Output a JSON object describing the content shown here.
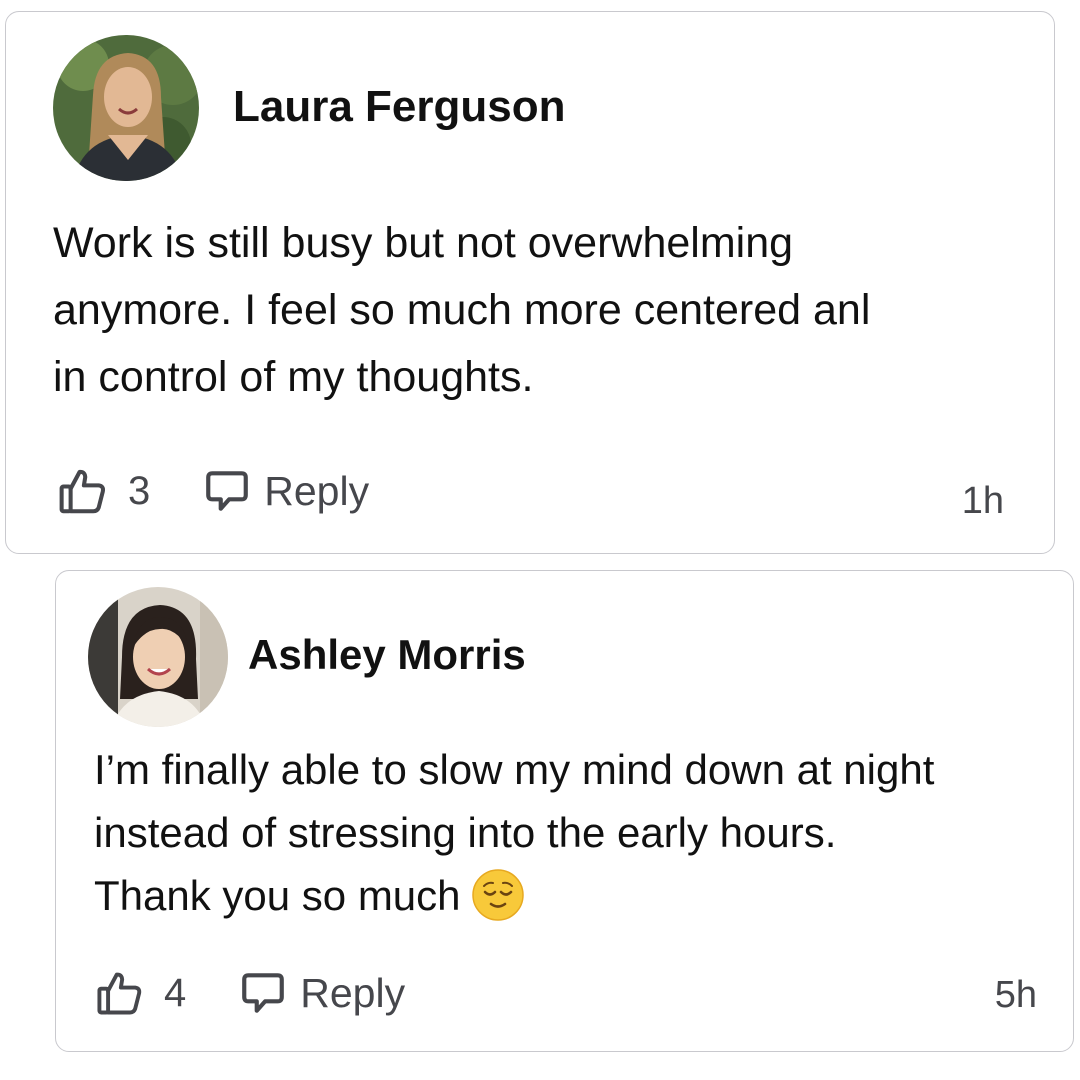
{
  "comments": [
    {
      "author": "Laura Ferguson",
      "body_lines": [
        "Work is still busy but not overwhelming",
        "anymore. I feel so much more centered anl",
        "in control of my thoughts."
      ],
      "likes": "3",
      "reply_label": "Reply",
      "timestamp": "1h",
      "avatar_icon": "avatar-photo-laura"
    },
    {
      "author": "Ashley Morris",
      "body_lines": [
        "I’m finally able to slow my mind down at night",
        "instead of stressing into the early hours.",
        "Thank you so much"
      ],
      "emoji": "relieved-face-emoji",
      "likes": "4",
      "reply_label": "Reply",
      "timestamp": "5h",
      "avatar_icon": "avatar-photo-ashley"
    }
  ],
  "colors": {
    "text": "#111111",
    "meta": "#46474c",
    "border": "#c9c9ce"
  }
}
